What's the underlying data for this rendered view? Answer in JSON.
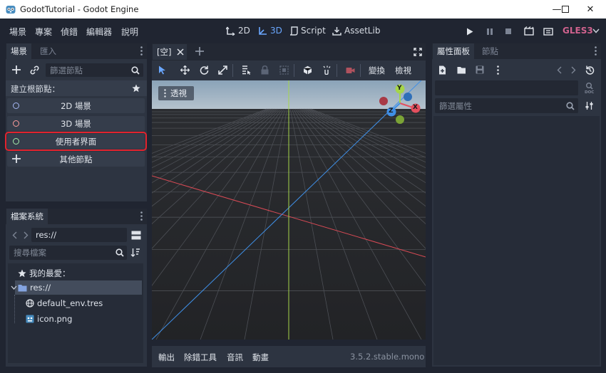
{
  "window": {
    "title": "GodotTutorial - Godot Engine",
    "app_icon": "godot-logo-icon",
    "minimize_glyph": "—",
    "maximize_glyph": "☐",
    "close_glyph": "✕"
  },
  "menubar": {
    "items": [
      "場景",
      "專案",
      "偵錯",
      "編輯器",
      "說明"
    ],
    "modes": [
      {
        "label": "2D",
        "icon": "2d-icon",
        "active": false
      },
      {
        "label": "3D",
        "icon": "3d-icon",
        "active": true
      },
      {
        "label": "Script",
        "icon": "script-icon",
        "active": false
      },
      {
        "label": "AssetLib",
        "icon": "assetlib-icon",
        "active": false
      }
    ],
    "renderer": "GLES3"
  },
  "scene_dock": {
    "tabs": [
      "場景",
      "匯入"
    ],
    "filter_placeholder": "篩選節點",
    "create_root_label": "建立根節點：",
    "root_nodes": [
      "2D 場景",
      "3D 場景",
      "使用者界面",
      "其他節點"
    ],
    "highlighted_node": "使用者界面"
  },
  "filesystem_dock": {
    "title": "檔案系統",
    "path": "res://",
    "search_placeholder": "搜尋檔案",
    "favorites_label": "我的最愛：",
    "root": "res://",
    "files": [
      "default_env.tres",
      "icon.png"
    ]
  },
  "viewport": {
    "tab_label": "[空]",
    "toolbar_labels": {
      "transform": "變換",
      "view": "檢視"
    },
    "view_mode_label": "透視",
    "gizmo_axes": {
      "y": "Y",
      "x": "X",
      "z": "Z"
    }
  },
  "bottom_panel": {
    "tabs": [
      "輸出",
      "除錯工具",
      "音訊",
      "動畫"
    ],
    "version": "3.5.2.stable.mono"
  },
  "inspector": {
    "tabs": [
      "屬性面板",
      "節點"
    ],
    "filter_placeholder": "篩選屬性"
  },
  "colors": {
    "accent": "#6aa7ff",
    "highlight_box": "#e2232e",
    "renderer": "#d0628e",
    "axis_x": "#e4505e",
    "axis_y": "#a5d54a",
    "axis_z": "#3f8fe6"
  }
}
